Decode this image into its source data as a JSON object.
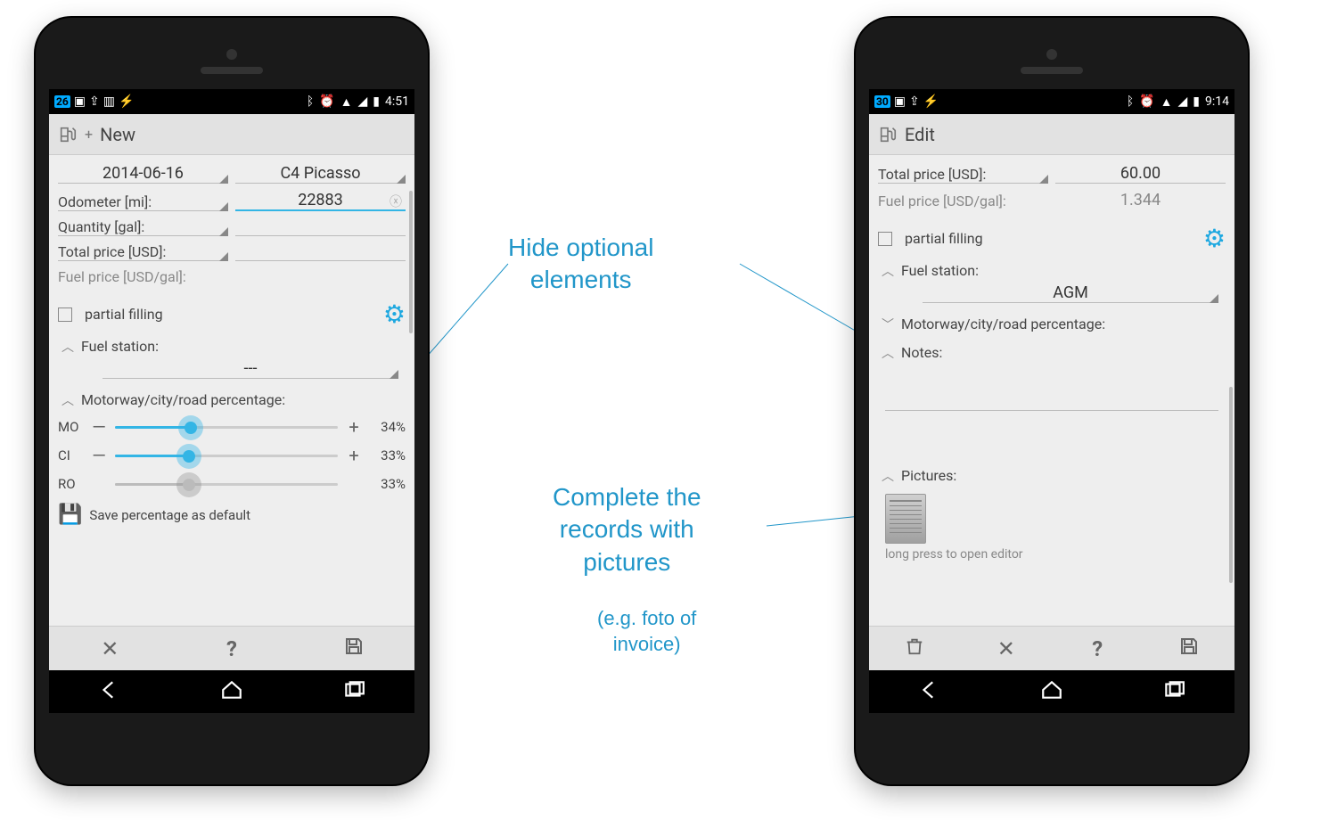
{
  "annotations": {
    "hide": "Hide optional\nelements",
    "pictures": "Complete the\nrecords with\npictures",
    "pictures_sub": "(e.g. foto of\ninvoice)"
  },
  "left": {
    "statusbar": {
      "badge": "26",
      "time": "4:51",
      "icons_left": [
        "image",
        "share",
        "barcode",
        "flash"
      ],
      "icons_right": [
        "bluetooth",
        "alarm",
        "wifi",
        "signal",
        "battery"
      ]
    },
    "title": "New",
    "date": "2014-06-16",
    "vehicle": "C4 Picasso",
    "fields": {
      "odometer_label": "Odometer [mi]:",
      "odometer_value": "22883",
      "quantity_label": "Quantity [gal]:",
      "quantity_value": "",
      "total_label": "Total price [USD]:",
      "total_value": "",
      "fuelprice_label": "Fuel price [USD/gal]:",
      "fuelprice_value": ""
    },
    "partial_label": "partial filling",
    "fuelstation_label": "Fuel station:",
    "fuelstation_value": "---",
    "percentage_label": "Motorway/city/road percentage:",
    "sliders": {
      "mo": {
        "label": "MO",
        "percent": 34,
        "text": "34%"
      },
      "ci": {
        "label": "CI",
        "percent": 33,
        "text": "33%"
      },
      "ro": {
        "label": "RO",
        "percent": 33,
        "text": "33%"
      }
    },
    "save_default": "Save percentage as default",
    "actions": [
      "cancel",
      "help",
      "save"
    ]
  },
  "right": {
    "statusbar": {
      "badge": "30",
      "time": "9:14",
      "icons_left": [
        "image",
        "share",
        "flash"
      ],
      "icons_right": [
        "bluetooth",
        "alarm",
        "wifi",
        "signal",
        "battery"
      ]
    },
    "title": "Edit",
    "fields": {
      "total_label": "Total price [USD]:",
      "total_value": "60.00",
      "fuelprice_label": "Fuel price [USD/gal]:",
      "fuelprice_value": "1.344"
    },
    "partial_label": "partial filling",
    "fuelstation_label": "Fuel station:",
    "fuelstation_value": "AGM",
    "percentage_label": "Motorway/city/road percentage:",
    "notes_label": "Notes:",
    "pictures_label": "Pictures:",
    "pictures_caption": "long press to open editor",
    "actions": [
      "delete",
      "cancel",
      "help",
      "save"
    ]
  }
}
